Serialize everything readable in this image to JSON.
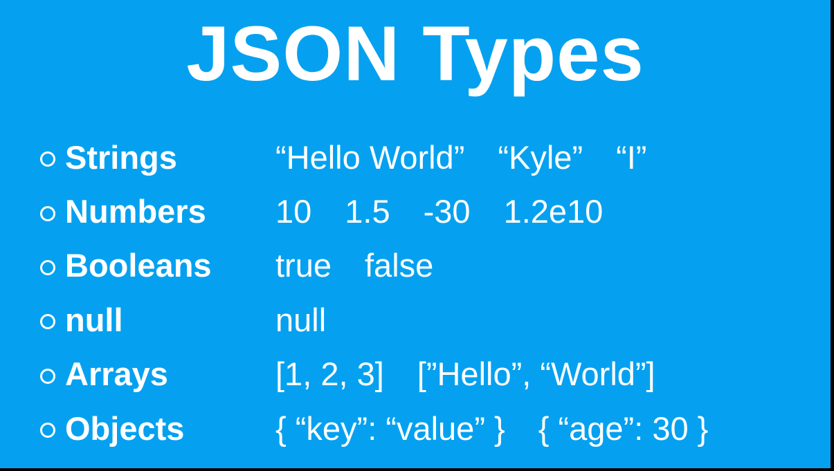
{
  "title": "JSON Types",
  "colors": {
    "background": "#05a1f0",
    "text": "#ffffff",
    "edge": "#000000"
  },
  "items": [
    {
      "label": "Strings",
      "examples": [
        "“Hello World”",
        "“Kyle”",
        "“I”"
      ]
    },
    {
      "label": "Numbers",
      "examples": [
        "10",
        "1.5",
        "-30",
        "1.2e10"
      ]
    },
    {
      "label": "Booleans",
      "examples": [
        "true",
        "false"
      ]
    },
    {
      "label": "null",
      "examples": [
        "null"
      ]
    },
    {
      "label": "Arrays",
      "examples": [
        "[1, 2, 3]",
        "[”Hello”, “World”]"
      ]
    },
    {
      "label": "Objects",
      "examples": [
        "{ “key”: “value” }",
        "{ “age”: 30 }"
      ]
    }
  ]
}
